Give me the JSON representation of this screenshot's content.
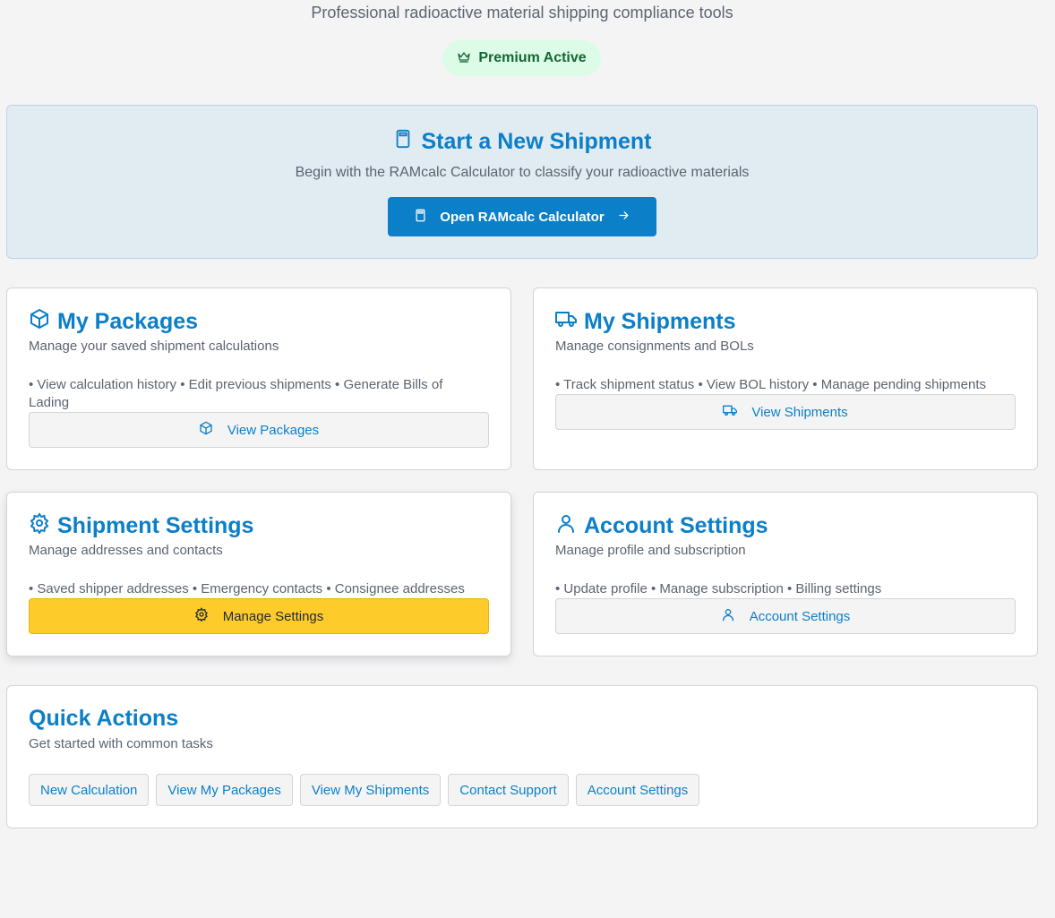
{
  "header": {
    "subtitle": "Professional radioactive material shipping compliance tools",
    "badge": "Premium Active",
    "badge_icon": "crown-icon"
  },
  "hero": {
    "title": "Start a New Shipment",
    "title_icon": "calculator-icon",
    "subtitle": "Begin with the RAMcalc Calculator to classify your radioactive materials",
    "button_label": "Open RAMcalc Calculator",
    "button_icon": "arrow-right-icon"
  },
  "cards": {
    "packages": {
      "title": "My Packages",
      "icon": "package-icon",
      "description": "Manage your saved shipment calculations",
      "bullets": "• View calculation history • Edit previous shipments • Generate Bills of Lading",
      "button_label": "View Packages"
    },
    "shipments": {
      "title": "My Shipments",
      "icon": "truck-icon",
      "description": "Manage consignments and BOLs",
      "bullets": "• Track shipment status • View BOL history • Manage pending shipments",
      "button_label": "View Shipments"
    },
    "shipment_settings": {
      "title": "Shipment Settings",
      "icon": "gear-icon",
      "description": "Manage addresses and contacts",
      "bullets": "• Saved shipper addresses • Emergency contacts • Consignee addresses",
      "button_label": "Manage Settings"
    },
    "account_settings": {
      "title": "Account Settings",
      "icon": "user-icon",
      "description": "Manage profile and subscription",
      "bullets": "• Update profile • Manage subscription • Billing settings",
      "button_label": "Account Settings"
    }
  },
  "quick_actions": {
    "title": "Quick Actions",
    "subtitle": "Get started with common tasks",
    "buttons": [
      "New Calculation",
      "View My Packages",
      "View My Shipments",
      "Contact Support",
      "Account Settings"
    ]
  },
  "colors": {
    "accent": "#0b7fc7",
    "highlight": "#fdcc2a",
    "premium_bg": "#dcfce7",
    "premium_text": "#166534"
  }
}
